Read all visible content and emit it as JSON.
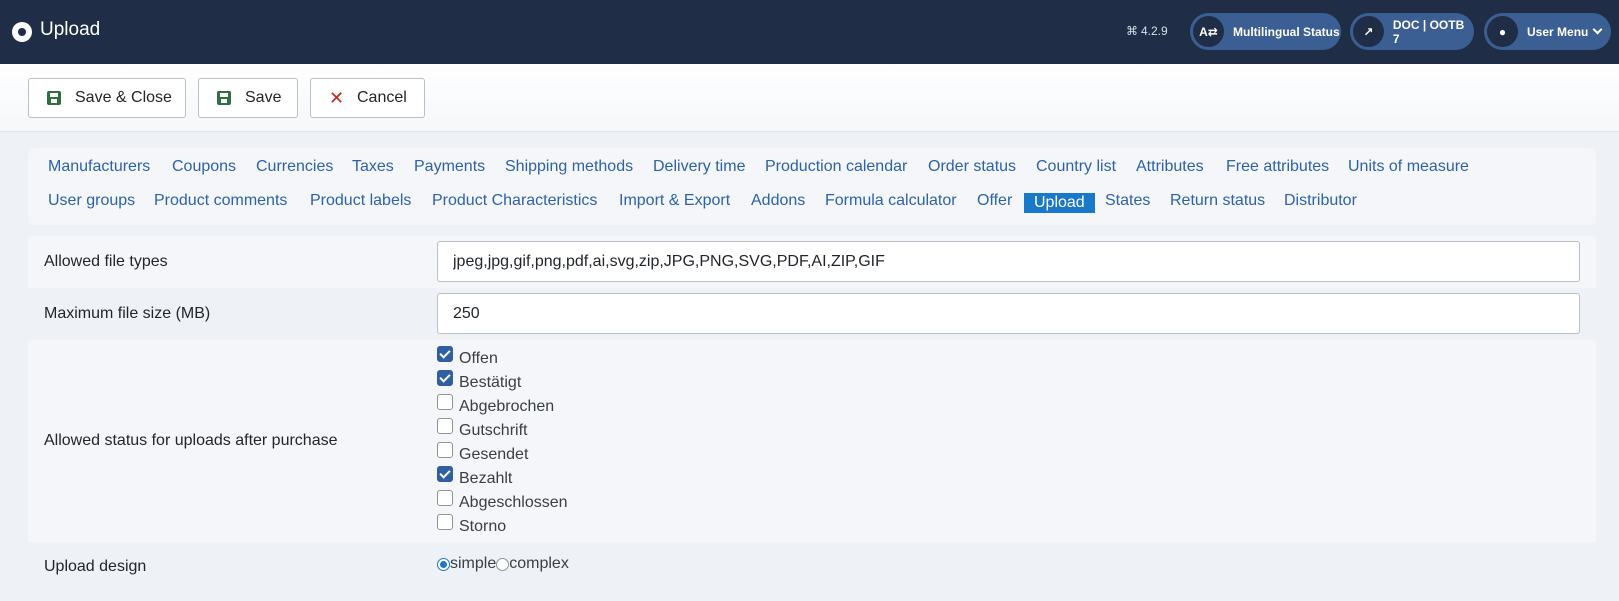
{
  "header": {
    "title": "Upload",
    "version": "4.2.9",
    "multilingual": "Multilingual Status",
    "doc": "DOC | OOTB 7",
    "user_menu": "User Menu"
  },
  "toolbar": {
    "save_close": "Save & Close",
    "save": "Save",
    "cancel": "Cancel"
  },
  "tabs": [
    "Manufacturers",
    "Coupons",
    "Currencies",
    "Taxes",
    "Payments",
    "Shipping methods",
    "Delivery time",
    "Production calendar",
    "Order status",
    "Country list",
    "Attributes",
    "Free attributes",
    "Units of measure",
    "User groups",
    "Product comments",
    "Product labels",
    "Product Characteristics",
    "Import & Export",
    "Addons",
    "Formula calculator",
    "Offer",
    "Upload",
    "States",
    "Return status",
    "Distributor"
  ],
  "active_tab": "Upload",
  "form": {
    "file_types_label": "Allowed file types",
    "file_types_value": "jpeg,jpg,gif,png,pdf,ai,svg,zip,JPG,PNG,SVG,PDF,AI,ZIP,GIF",
    "max_size_label": "Maximum file size (MB)",
    "max_size_value": "250",
    "status_label": "Allowed status for uploads after purchase",
    "statuses": [
      {
        "label": "Offen",
        "checked": true
      },
      {
        "label": "Bestätigt",
        "checked": true
      },
      {
        "label": "Abgebrochen",
        "checked": false
      },
      {
        "label": "Gutschrift",
        "checked": false
      },
      {
        "label": "Gesendet",
        "checked": false
      },
      {
        "label": "Bezahlt",
        "checked": true
      },
      {
        "label": "Abgeschlossen",
        "checked": false
      },
      {
        "label": "Storno",
        "checked": false
      }
    ],
    "design_label": "Upload design",
    "design_options": [
      "simple",
      "complex"
    ],
    "design_selected": "simple"
  }
}
